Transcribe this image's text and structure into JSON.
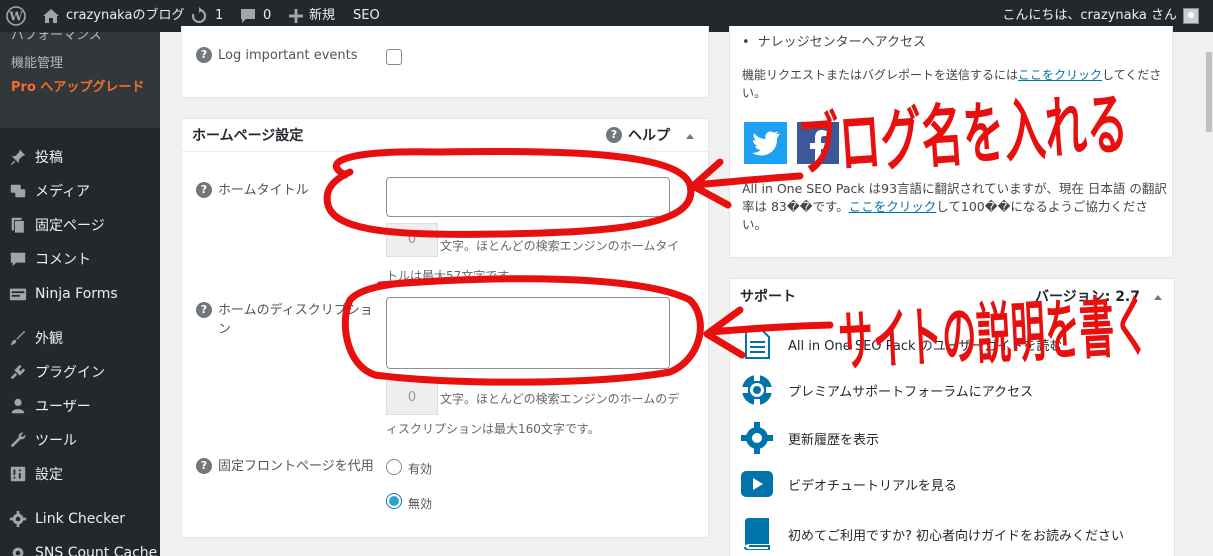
{
  "admin_bar": {
    "site_name": "crazynakaのブログ",
    "updates_count": "1",
    "comments_count": "0",
    "new_label": "新規",
    "seo_label": "SEO",
    "greeting": "こんにちは、crazynaka さん"
  },
  "sidebar": {
    "submenu_partial": "パフォーマンス",
    "submenu_features": "機能管理",
    "submenu_pro": "Pro へアップグレード",
    "items": [
      {
        "label": "投稿",
        "icon": "pin-icon"
      },
      {
        "label": "メディア",
        "icon": "media-icon"
      },
      {
        "label": "固定ページ",
        "icon": "page-icon"
      },
      {
        "label": "コメント",
        "icon": "comment-icon"
      },
      {
        "label": "Ninja Forms",
        "icon": "form-icon"
      },
      {
        "label": "外観",
        "icon": "brush-icon"
      },
      {
        "label": "プラグイン",
        "icon": "plugin-icon"
      },
      {
        "label": "ユーザー",
        "icon": "user-icon"
      },
      {
        "label": "ツール",
        "icon": "wrench-icon"
      },
      {
        "label": "設定",
        "icon": "settings-icon"
      },
      {
        "label": "Link Checker",
        "icon": "gear-icon"
      },
      {
        "label": "SNS Count Cache",
        "icon": "gear-icon"
      }
    ]
  },
  "log_panel": {
    "log_label": "Log important events",
    "log_checked": false
  },
  "homepage": {
    "title": "ホームページ設定",
    "help_label": "ヘルプ",
    "home_title_label": "ホームタイトル",
    "home_title_value": "",
    "home_title_count": "0",
    "home_title_help": "文字。ほとんどの検索エンジンのホームタイトルは最大57文字です。",
    "home_desc_label": "ホームのディスクリプション",
    "home_desc_value": "",
    "home_desc_count": "0",
    "home_desc_help": "文字。ほとんどの検索エンジンのホームのディスクリプションは最大160文字です。",
    "static_front_label": "固定フロントページを代用",
    "option_enabled": "有効",
    "option_disabled": "無効",
    "selected": "無効"
  },
  "info_panel": {
    "bullet_knowledge": "ナレッジセンターへアクセス",
    "feature_request": "機能リクエストまたはバグレポートを送信するには",
    "click_here": "ここをクリック",
    "feature_request_tail": "してください。",
    "translation_text": "All in One SEO Pack は93言語に翻訳されていますが、現在 日本語 の翻訳率は 83��です。",
    "translation_link": "ここをクリック",
    "translation_tail": "して100��になるようご協力ください。"
  },
  "support": {
    "title": "サポート",
    "version_label": "バージョン: 2.7",
    "items": [
      {
        "label": "All in One SEO Pack のユーザーガイドを読む",
        "icon": "document-icon"
      },
      {
        "label": "プレミアムサポートフォーラムにアクセス",
        "icon": "lifebuoy-icon"
      },
      {
        "label": "更新履歴を表示",
        "icon": "gear-icon"
      },
      {
        "label": "ビデオチュートリアルを見る",
        "icon": "video-icon"
      },
      {
        "label": "初めてご利用ですか? 初心者向けガイドをお読みください",
        "icon": "book-icon"
      }
    ]
  },
  "annotations": {
    "text_top": "ブログ名を入れる",
    "text_bottom": "サイトの説明を書く",
    "color": "#e8100e"
  },
  "colors": {
    "admin_bar_bg": "#23282d",
    "sidebar_bg": "#23282d",
    "pro_orange": "#f56e28",
    "link_blue": "#0073aa",
    "radio_selected": "#2ea2cc",
    "twitter_blue": "#1da1f2",
    "facebook_blue": "#3b5998"
  }
}
